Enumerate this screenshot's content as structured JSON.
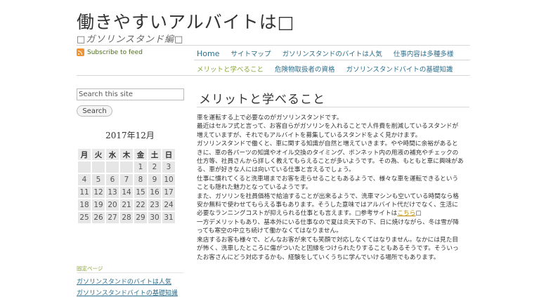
{
  "site": {
    "title": "働きやすいアルバイトは□",
    "description": "□ガソリンスタンド編□"
  },
  "feed": {
    "label": "Subscribe to feed",
    "icon": "rss-icon"
  },
  "nav": {
    "row1": [
      {
        "label": "Home"
      },
      {
        "label": "サイトマップ"
      },
      {
        "label": "ガソリンスタンドのバイトは人気"
      },
      {
        "label": "仕事内容は多種多様"
      }
    ],
    "row2": [
      {
        "label": "メリットと学べること"
      },
      {
        "label": "危険物取扱者の資格"
      },
      {
        "label": "ガソリンスタンドバイトの基礎知識"
      }
    ]
  },
  "search": {
    "placeholder": "Search this site",
    "value": "Search this site",
    "button": "Search"
  },
  "calendar": {
    "caption": "2017年12月",
    "weekdays": [
      "月",
      "火",
      "水",
      "木",
      "金",
      "土",
      "日"
    ],
    "weeks": [
      [
        "",
        "",
        "",
        "",
        "1",
        "2",
        "3"
      ],
      [
        "4",
        "5",
        "6",
        "7",
        "8",
        "9",
        "10"
      ],
      [
        "11",
        "12",
        "13",
        "14",
        "15",
        "16",
        "17"
      ],
      [
        "18",
        "19",
        "20",
        "21",
        "22",
        "23",
        "24"
      ],
      [
        "25",
        "26",
        "27",
        "28",
        "29",
        "30",
        "31"
      ]
    ]
  },
  "fixed_pages": {
    "label": "固定ページ",
    "links": [
      "ガソリンスタンドのバイトは人気",
      "ガソリンスタンドバイトの基礎知識"
    ]
  },
  "post": {
    "title": "メリットと学べること",
    "p1": "車を運転する上で必要なのがガソリンスタンドです。",
    "p2": "最近はセルフ式と言って、お客自らがガソリンを入れることで人件費を削減しているスタンドが増えていますが、それでもアルバイトを募集しているスタンドをよく見かけます。",
    "p3": "ガソリンスタンドで働くと、車に関する知識が自然と増えていきます。やや時間に余裕があるときに、車の各パーツの知識やオイル交換のタイミング、ボンネット内の用液の補充やチェックの仕方等、社員さんから詳しく教えてもらえることが多いようです。その為、もともと車に興味がある、車が好きな人には向いている仕事と言えるでしょう。",
    "p4": "仕事に慣れてくると洗車場までお客を走らせることもあるようで、様々な車を運転できるということも隠れた魅力となっているようです。",
    "p5_before": "また、ガソリンを社員価格で給油することが出来るようで、洗車マシンも空いている時間なら格安か無料で使わせてもらえる事もあります。そうした意味ではアルバイト代だけでなく、生活に必要なランニングコストが抑えられる仕事とも言えます。□参考サイトは",
    "p5_link": "こちら",
    "p5_after": "□",
    "p6": "一方デメリットもあり、基本外にいる仕事なので夏は炎天下の下、日に焼けながら、冬は雪が降っても寒空の中立ち続けて働かなくてはなりません。",
    "p7": "来店するお客も様々で、どんなお客が来ても笑顔で対応しなくてはなりません。なかには見た目が怖く、洗車したところに傷がついたと因縁をつけられたりすることもあるそうです。そういったお客さんにどう対応するかも、経験をしていくうちに学んでいける場所でもあります。"
  }
}
